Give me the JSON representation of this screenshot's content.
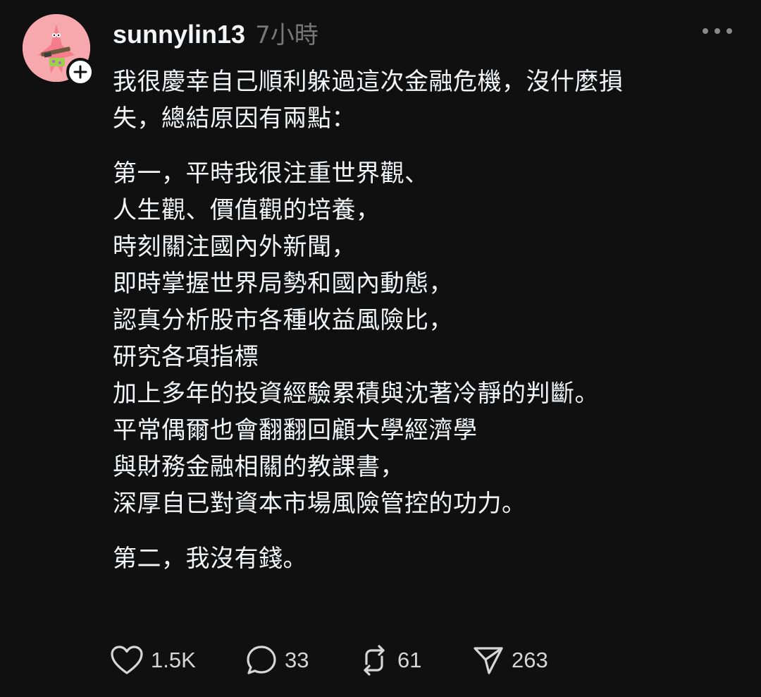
{
  "post": {
    "username": "sunnylin13",
    "timestamp": "7小時",
    "paragraphs": [
      [
        "我很慶幸自己順利躲過這次金融危機，沒什麼損",
        "失，總結原因有兩點："
      ],
      [
        "第一，平時我很注重世界觀、",
        "人生觀、價值觀的培養，",
        "時刻關注國內外新聞，",
        "即時掌握世界局勢和國內動態，",
        "認真分析股市各種收益風險比，",
        "研究各項指標",
        "加上多年的投資經驗累積與沈著冷靜的判斷。",
        "平常偶爾也會翻翻回顧大學經濟學",
        "與財務金融相關的教課書，",
        "深厚自已對資本市場風險管控的功力。"
      ],
      [
        "第二，我沒有錢。"
      ]
    ]
  },
  "actions": {
    "likes": "1.5K",
    "replies": "33",
    "reposts": "61",
    "shares": "263"
  },
  "icons": {
    "avatar": "patrick-star-avatar",
    "follow": "plus-icon",
    "more": "more-dots-icon",
    "like": "heart-icon",
    "reply": "comment-bubble-icon",
    "repost": "repost-icon",
    "share": "send-icon"
  },
  "colors": {
    "background": "#101010",
    "text": "#f3f5f7",
    "muted": "#777777",
    "avatar_bg": "#f6a8ad"
  }
}
